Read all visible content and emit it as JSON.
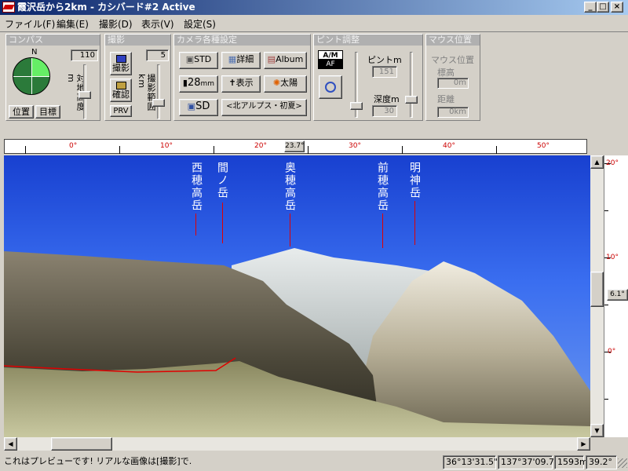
{
  "window": {
    "title": "霞沢岳から2km - カシバード#2 Active"
  },
  "menu": [
    "ファイル(F)",
    "編集(E)",
    "撮影(D)",
    "表示(V)",
    "設定(S)"
  ],
  "compass": {
    "title": "コンパス",
    "north": "N",
    "relative_height": "110",
    "height_label": "対地高度m",
    "buttons": [
      "位置",
      "目標"
    ]
  },
  "shoot": {
    "title": "撮影",
    "range": "5",
    "range_label": "撮影範囲km",
    "shoot_btn": "撮影",
    "confirm_btn": "確認",
    "prv": "PRV"
  },
  "camera": {
    "title": "カメラ各種設定",
    "std": "STD",
    "detail": "詳細",
    "album": "Album",
    "lens": "28",
    "lens_unit": "mm",
    "display": "表示",
    "sun": "太陽",
    "sd": "SD",
    "preset": "<北アルプス・初夏>"
  },
  "focus": {
    "title": "ピント調整",
    "am": "A/M",
    "af": "AF",
    "focus_label": "ピントm",
    "focus_value": "151",
    "depth_label": "深度m",
    "depth_value": "30"
  },
  "mouse": {
    "title": "マウス位置",
    "pos_label": "マウス位置",
    "height_label": "標高",
    "height_value": "0m",
    "dist_label": "距離",
    "dist_value": "0km"
  },
  "ruler": {
    "labels": [
      "0°",
      "10°",
      "20°",
      "30°",
      "40°",
      "50°"
    ],
    "current": "23.7°"
  },
  "peaks": [
    {
      "name": "西穂高岳"
    },
    {
      "name": "間ノ岳"
    },
    {
      "name": "奥穂高岳"
    },
    {
      "name": "前穂高岳"
    },
    {
      "name": "明神岳"
    }
  ],
  "elevation": {
    "labels": [
      "20°",
      "10°",
      "0°"
    ],
    "current": "6.1°"
  },
  "status": {
    "message": "これはプレビューです! リアルな画像は[撮影]で.",
    "lat": "36°13'31.5\"",
    "lon": "137°37'09.7\"",
    "alt": "1593m",
    "angle": "39.2°"
  },
  "colors": {
    "titlebar": "#0a246a",
    "sky": "#1840d0",
    "marker": "#e00000"
  }
}
